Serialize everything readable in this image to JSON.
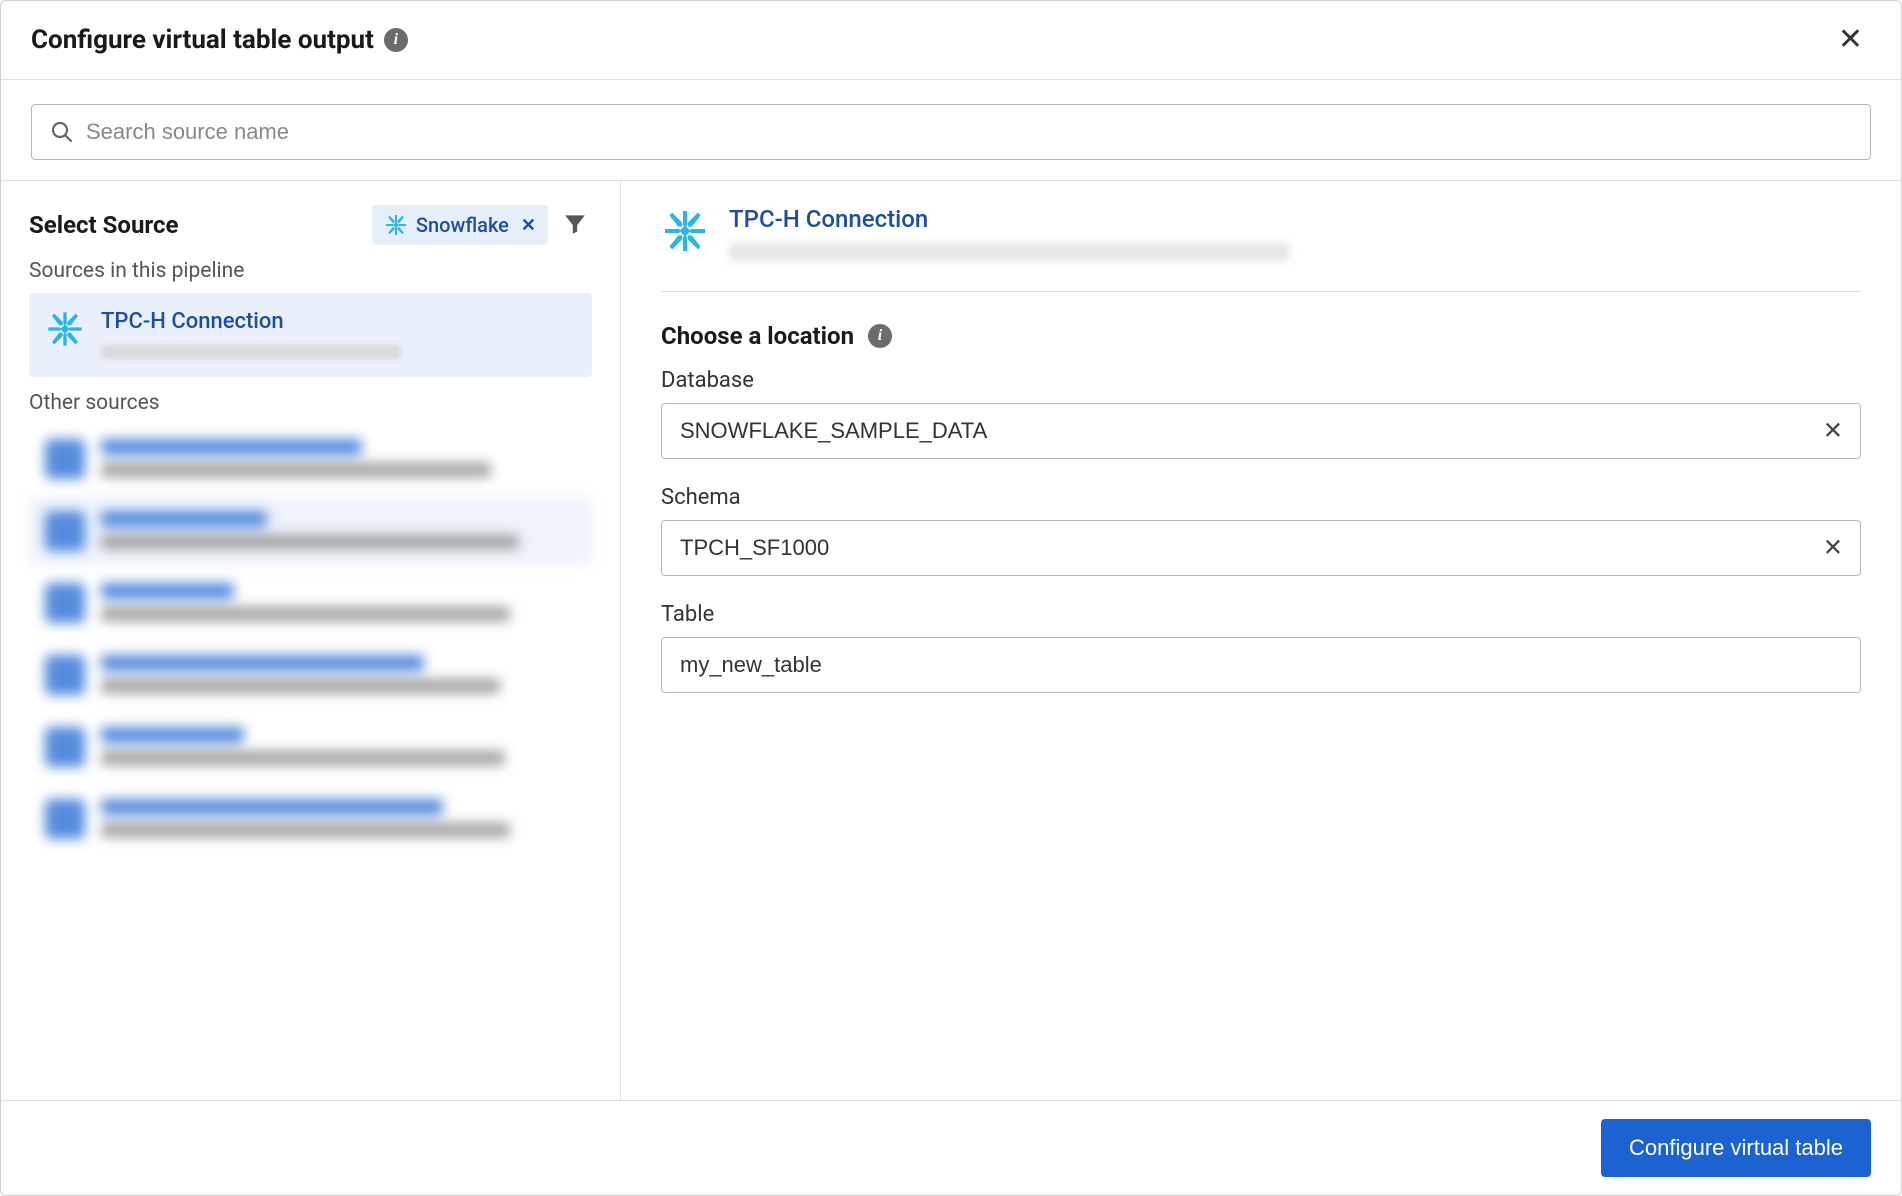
{
  "header": {
    "title": "Configure virtual table output"
  },
  "search": {
    "placeholder": "Search source name"
  },
  "left": {
    "title": "Select Source",
    "filter_chip": "Snowflake",
    "section_pipeline": "Sources in this pipeline",
    "section_other": "Other sources",
    "pipeline_sources": [
      {
        "name": "TPC-H Connection"
      }
    ],
    "other_source_count": 6
  },
  "right": {
    "connection_name": "TPC-H Connection",
    "section_title": "Choose a location",
    "fields": {
      "database": {
        "label": "Database",
        "value": "SNOWFLAKE_SAMPLE_DATA",
        "clearable": true
      },
      "schema": {
        "label": "Schema",
        "value": "TPCH_SF1000",
        "clearable": true
      },
      "table": {
        "label": "Table",
        "value": "my_new_table",
        "clearable": false
      }
    }
  },
  "footer": {
    "primary": "Configure virtual table"
  },
  "colors": {
    "accent": "#1d62d1",
    "link": "#1d4f9e",
    "chip_bg": "#e6eefa",
    "selected_bg": "#eaf0fb"
  }
}
